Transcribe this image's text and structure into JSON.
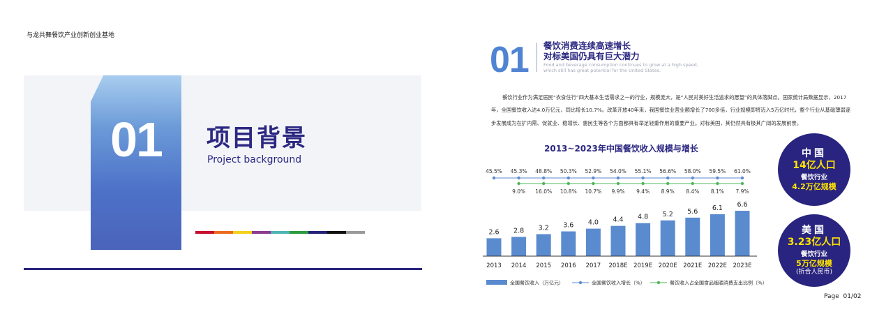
{
  "left_page": {
    "header": "与龙共舞餐饮产业创新创业基地",
    "section_number": "01",
    "title_cn": "项目背景",
    "title_en": "Project background",
    "color_strip": [
      "#c8102e",
      "#ec6c1f",
      "#f2d21b",
      "#8d3c8e",
      "#4fb5b5",
      "#2e9b3f",
      "#26227a",
      "#111111",
      "#9a9a9a"
    ]
  },
  "right_page": {
    "number": "01",
    "heading_line1": "餐饮消费连续高速增长",
    "heading_line2": "对标美国仍具有巨大潜力",
    "subheading_en_line1": "Food and beverage consumption continues to grow at a high speed,",
    "subheading_en_line2": "which still has great potential for the United States.",
    "paragraph": "餐饮行业作为满足居民“衣食住行”四大基本生活需求之一的行业，规模庞大，是“人民对美好生活追求的愿望”的具体落脚点。国家统计局数据显示，2017年，全国餐饮收入达4.0万亿元，同比增长10.7%。改革开放40年来，我国餐饮业营业额增长了700多倍，行业规模即将迈入5万亿时代，整个行业从基础薄弱逐步发展成为在扩内需、促就业、稳增长、惠民生等各个方面都具有举足轻重作用的重要产业。对标美国，其仍然具有极其广阔的发展前景。",
    "chart_title": "2013~2023年中国餐饮收入规模与增长",
    "china": {
      "country": "中国",
      "population": "14亿人口",
      "industry": "餐饮行业",
      "scale": "4.2万亿规模"
    },
    "usa": {
      "country": "美国",
      "population": "3.23亿人口",
      "industry": "餐饮行业",
      "scale": "5万亿规模",
      "note": "(折合人民币)"
    },
    "page_label": "Page",
    "page_number": "01/02"
  },
  "chart_data": {
    "type": "bar",
    "title": "2013~2023年中国餐饮收入规模与增长",
    "categories": [
      "2013",
      "2014",
      "2015",
      "2016",
      "2017",
      "2018E",
      "2019E",
      "2020E",
      "2021E",
      "2022E",
      "2023E"
    ],
    "series": [
      {
        "name": "全国餐饮收入（万亿元）",
        "type": "bar",
        "color": "#5b8bcf",
        "values": [
          2.6,
          2.8,
          3.2,
          3.6,
          4.0,
          4.4,
          4.8,
          5.2,
          5.6,
          6.1,
          6.6
        ],
        "labels": [
          "2.6",
          "2.8",
          "3.2",
          "3.6",
          "4.0",
          "4.4",
          "4.8",
          "5.2",
          "5.6",
          "6.1",
          "6.6"
        ]
      },
      {
        "name": "全国餐饮收入增长（%）",
        "type": "line",
        "color": "#5b8bcf",
        "values": [
          45.5,
          45.3,
          48.8,
          50.3,
          52.9,
          54.0,
          55.1,
          56.6,
          58.0,
          59.5,
          61.0
        ],
        "labels": [
          "45.5%",
          "45.3%",
          "48.8%",
          "50.3%",
          "52.9%",
          "54.0%",
          "55.1%",
          "56.6%",
          "58.0%",
          "59.5%",
          "61.0%"
        ]
      },
      {
        "name": "餐饮收入占全国食品烟酒消费支出比例（%）",
        "type": "line",
        "color": "#4cb85a",
        "values": [
          null,
          9.0,
          16.0,
          10.8,
          10.7,
          9.9,
          9.4,
          8.9,
          8.4,
          8.1,
          7.9
        ],
        "labels": [
          "",
          "9.0%",
          "16.0%",
          "10.8%",
          "10.7%",
          "9.9%",
          "9.4%",
          "8.9%",
          "8.4%",
          "8.1%",
          "7.9%"
        ]
      }
    ],
    "ylim": [
      0,
      7
    ],
    "grid": false,
    "legend_position": "bottom"
  }
}
